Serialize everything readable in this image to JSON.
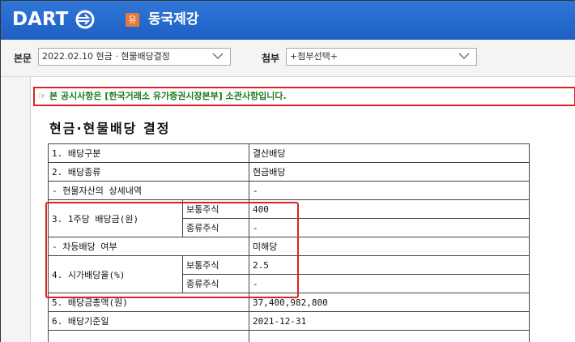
{
  "header": {
    "logo": "DART",
    "badge": "유",
    "company": "동국제강"
  },
  "toolbar": {
    "report_label": "본문",
    "report_value": "2022.02.10  현금 · 현물배당결정",
    "attach_label": "첨부",
    "attach_value": "+첨부선택+"
  },
  "notice": {
    "icon": "hand-pointer-icon",
    "text": "본 공시사항은 [한국거래소 유가증권시장본부] 소관사항입니다."
  },
  "doc": {
    "title": "현금·현물배당 결정",
    "rows": [
      {
        "label": "1. 배당구분",
        "value": "결산배당"
      },
      {
        "label": "2. 배당종류",
        "value": "현금배당"
      },
      {
        "label": "- 현물자산의 상세내역",
        "value": "-"
      },
      {
        "label": "3. 1주당 배당금(원)",
        "sub1": "보통주식",
        "val1": "400",
        "sub2": "종류주식",
        "val2": "-"
      },
      {
        "label": "- 차등배당 여부",
        "value": "미해당"
      },
      {
        "label": "4. 시가배당율(%)",
        "sub1": "보통주식",
        "val1": "2.5",
        "sub2": "종류주식",
        "val2": "-"
      },
      {
        "label": "5. 배당금총액(원)",
        "value": "37,400,982,800"
      },
      {
        "label": "6. 배당기준일",
        "value": "2021-12-31"
      }
    ]
  },
  "colors": {
    "header_blue": "#2568d0",
    "badge_orange": "#e8793a",
    "highlight_red": "#e02020",
    "notice_green": "#1f7a1f"
  }
}
